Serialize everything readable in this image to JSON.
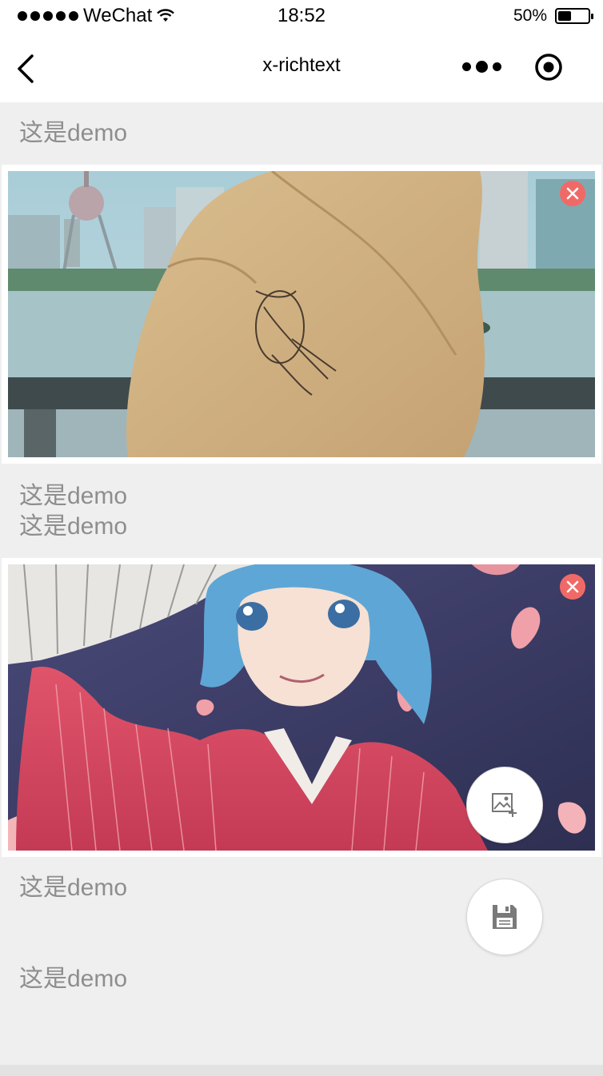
{
  "status_bar": {
    "carrier": "WeChat",
    "time": "18:52",
    "battery_percent": "50%",
    "battery_level": 0.5,
    "signal_dots": 5
  },
  "nav": {
    "title": "x-richtext"
  },
  "editor": {
    "blocks": [
      {
        "type": "text",
        "lines": [
          "这是demo"
        ]
      },
      {
        "type": "image",
        "subject": "person in beige hooded jacket by river skyline"
      },
      {
        "type": "text",
        "lines": [
          "这是demo",
          "这是demo"
        ]
      },
      {
        "type": "image",
        "subject": "anime girl with blue hair and red kimono holding fan"
      },
      {
        "type": "text",
        "lines": [
          "这是demo"
        ]
      },
      {
        "type": "text",
        "lines": [
          "这是demo"
        ]
      }
    ]
  },
  "actions": {
    "add_image_icon": "image-add-icon",
    "save_icon": "floppy-disk-icon",
    "delete_icon": "close-circle-icon"
  },
  "colors": {
    "delete": "#ef6a67",
    "text": "#8e8e8e",
    "background": "#efefef"
  }
}
